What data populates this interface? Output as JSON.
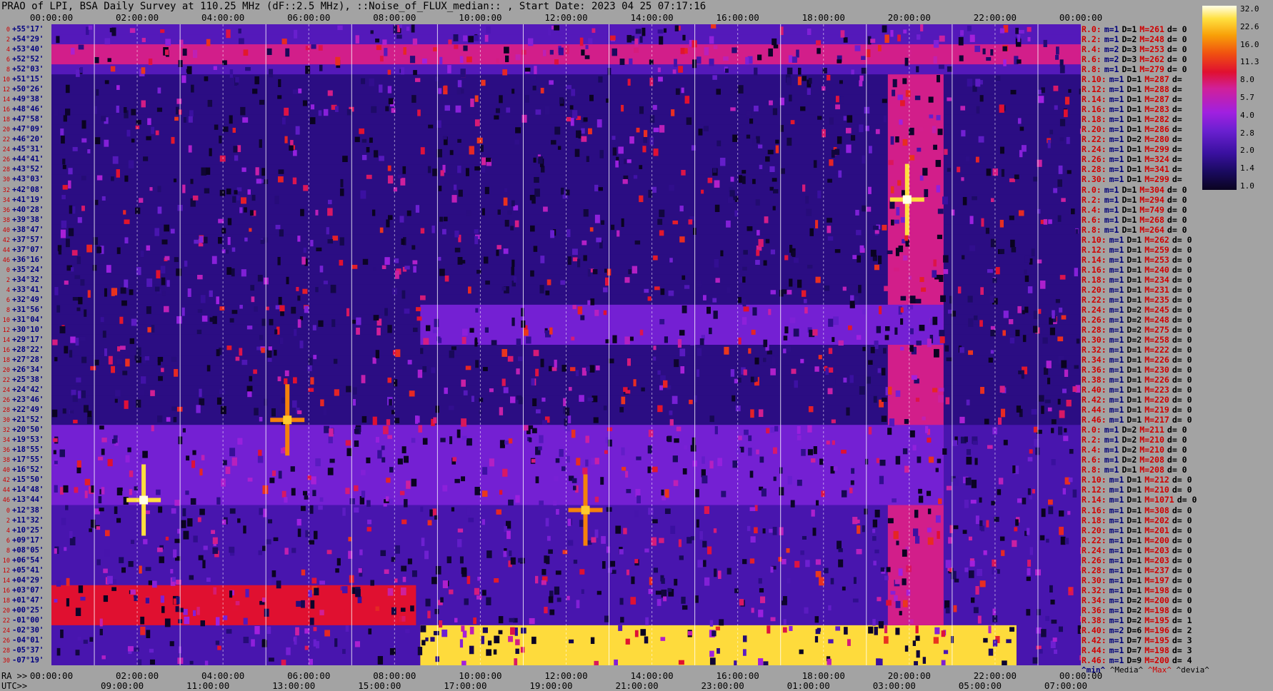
{
  "title": "PRAO of LPI, BSA Daily Survey at 110.25 MHz (dF::2.5 MHz), ::Noise_of_FLUX_median:: , Start Date: 2023 04 25 07:17:16",
  "top_axis_ticks": [
    "00:00:00",
    "02:00:00",
    "04:00:00",
    "06:00:00",
    "08:00:00",
    "10:00:00",
    "12:00:00",
    "14:00:00",
    "16:00:00",
    "18:00:00",
    "20:00:00",
    "22:00:00",
    "00:00:00"
  ],
  "ra_axis": {
    "caption": "RA >>",
    "ticks": [
      "00:00:00",
      "02:00:00",
      "04:00:00",
      "06:00:00",
      "08:00:00",
      "10:00:00",
      "12:00:00",
      "14:00:00",
      "16:00:00",
      "18:00:00",
      "20:00:00",
      "22:00:00",
      "00:00:00"
    ]
  },
  "utc_axis": {
    "caption": "UTC>>",
    "ticks": [
      "09:00:00",
      "11:00:00",
      "13:00:00",
      "15:00:00",
      "17:00:00",
      "19:00:00",
      "21:00:00",
      "23:00:00",
      "01:00:00",
      "03:00:00",
      "05:00:00",
      "07:00:00"
    ]
  },
  "colorbar": {
    "ticks": [
      "32.0",
      "22.6",
      "16.0",
      "11.3",
      "8.0",
      "5.7",
      "4.0",
      "2.8",
      "2.0",
      "1.4",
      "1.0"
    ]
  },
  "legend": {
    "min": "^min^",
    "media": "^Media^",
    "max": "^Max^",
    "devia": "^devia^"
  },
  "chart_data": {
    "type": "heatmap",
    "title": "PRAO of LPI, BSA Daily Survey at 110.25 MHz (dF::2.5 MHz), ::Noise_of_FLUX_median:: , Start Date: 2023 04 25 07:17:16",
    "xlabel": "RA / UTC",
    "ylabel": "",
    "x_range_hours": [
      0,
      24
    ],
    "colorbar_range": [
      1.0,
      32.0
    ],
    "colorbar_scale": "log",
    "colors": {
      "low": "#0a0320",
      "mid": "#a020e0",
      "high": "#ffffe8"
    },
    "declinations": [
      "+55°17'",
      "+54°29'",
      "+53°40'",
      "+52°52'",
      "+52°03'",
      "+51°15'",
      "+50°26'",
      "+49°38'",
      "+48°46'",
      "+47°58'",
      "+47°09'",
      "+46°20'",
      "+45°31'",
      "+44°41'",
      "+43°52'",
      "+43°03'",
      "+42°08'",
      "+41°19'",
      "+40°28'",
      "+39°38'",
      "+38°47'",
      "+37°57'",
      "+37°07'",
      "+36°16'",
      "+35°24'",
      "+34°32'",
      "+33°41'",
      "+32°49'",
      "+31°56'",
      "+31°04'",
      "+30°10'",
      "+29°17'",
      "+28°22'",
      "+27°28'",
      "+26°34'",
      "+25°38'",
      "+24°42'",
      "+23°46'",
      "+22°49'",
      "+21°52'",
      "+20°50'",
      "+19°53'",
      "+18°55'",
      "+17°55'",
      "+16°52'",
      "+15°50'",
      "+14°48'",
      "+13°44'",
      "+12°38'",
      "+11°32'",
      "+10°25'",
      "+09°17'",
      "+08°05'",
      "+06°54'",
      "+05°41'",
      "+04°29'",
      "+03°07'",
      "+01°47'",
      "+00°25'",
      "-01°00'",
      "-02°30'",
      "-04°01'",
      "-05°37'",
      "-07°19'"
    ],
    "row_indices": [
      0,
      2,
      4,
      6,
      8,
      10,
      12,
      14,
      16,
      18,
      20,
      22,
      24,
      26,
      28,
      30,
      32,
      34,
      36,
      38,
      40,
      42,
      44,
      46,
      0,
      2,
      4,
      6,
      8,
      10,
      12,
      14,
      16,
      18,
      20,
      22,
      24,
      26,
      28,
      30,
      32,
      34,
      36,
      38,
      40,
      42,
      44,
      46,
      0,
      2,
      4,
      6,
      8,
      10,
      12,
      14,
      16,
      18,
      20,
      22,
      24,
      26,
      28,
      30,
      32,
      34,
      36,
      38,
      40,
      42,
      44,
      46
    ],
    "beam_stats": [
      {
        "r": "R.0:",
        "m": "m=1",
        "D": "D=1",
        "M": "M=261",
        "d": "d= 0"
      },
      {
        "r": "R.2:",
        "m": "m=1",
        "D": "D=2",
        "M": "M=248",
        "d": "d= 0"
      },
      {
        "r": "R.4:",
        "m": "m=2",
        "D": "D=3",
        "M": "M=253",
        "d": "d= 0"
      },
      {
        "r": "R.6:",
        "m": "m=2",
        "D": "D=3",
        "M": "M=262",
        "d": "d= 0"
      },
      {
        "r": "R.8:",
        "m": "m=1",
        "D": "D=1",
        "M": "M=279",
        "d": "d= 0"
      },
      {
        "r": "R.10:",
        "m": "m=1",
        "D": "D=1",
        "M": "M=287",
        "d": "d="
      },
      {
        "r": "R.12:",
        "m": "m=1",
        "D": "D=1",
        "M": "M=288",
        "d": "d="
      },
      {
        "r": "R.14:",
        "m": "m=1",
        "D": "D=1",
        "M": "M=287",
        "d": "d="
      },
      {
        "r": "R.16:",
        "m": "m=1",
        "D": "D=1",
        "M": "M=283",
        "d": "d="
      },
      {
        "r": "R.18:",
        "m": "m=1",
        "D": "D=1",
        "M": "M=282",
        "d": "d="
      },
      {
        "r": "R.20:",
        "m": "m=1",
        "D": "D=1",
        "M": "M=286",
        "d": "d="
      },
      {
        "r": "R.22:",
        "m": "m=1",
        "D": "D=2",
        "M": "M=280",
        "d": "d="
      },
      {
        "r": "R.24:",
        "m": "m=1",
        "D": "D=1",
        "M": "M=299",
        "d": "d="
      },
      {
        "r": "R.26:",
        "m": "m=1",
        "D": "D=1",
        "M": "M=324",
        "d": "d="
      },
      {
        "r": "R.28:",
        "m": "m=1",
        "D": "D=1",
        "M": "M=341",
        "d": "d="
      },
      {
        "r": "R.30:",
        "m": "m=1",
        "D": "D=1",
        "M": "M=299",
        "d": "d="
      },
      {
        "r": "R.0:",
        "m": "m=1",
        "D": "D=1",
        "M": "M=304",
        "d": "d= 0"
      },
      {
        "r": "R.2:",
        "m": "m=1",
        "D": "D=1",
        "M": "M=294",
        "d": "d= 0"
      },
      {
        "r": "R.4:",
        "m": "m=1",
        "D": "D=1",
        "M": "M=749",
        "d": "d= 0"
      },
      {
        "r": "R.6:",
        "m": "m=1",
        "D": "D=1",
        "M": "M=268",
        "d": "d= 0"
      },
      {
        "r": "R.8:",
        "m": "m=1",
        "D": "D=1",
        "M": "M=264",
        "d": "d= 0"
      },
      {
        "r": "R.10:",
        "m": "m=1",
        "D": "D=1",
        "M": "M=262",
        "d": "d= 0"
      },
      {
        "r": "R.12:",
        "m": "m=1",
        "D": "D=1",
        "M": "M=259",
        "d": "d= 0"
      },
      {
        "r": "R.14:",
        "m": "m=1",
        "D": "D=1",
        "M": "M=253",
        "d": "d= 0"
      },
      {
        "r": "R.16:",
        "m": "m=1",
        "D": "D=1",
        "M": "M=240",
        "d": "d= 0"
      },
      {
        "r": "R.18:",
        "m": "m=1",
        "D": "D=1",
        "M": "M=234",
        "d": "d= 0"
      },
      {
        "r": "R.20:",
        "m": "m=1",
        "D": "D=1",
        "M": "M=231",
        "d": "d= 0"
      },
      {
        "r": "R.22:",
        "m": "m=1",
        "D": "D=1",
        "M": "M=235",
        "d": "d= 0"
      },
      {
        "r": "R.24:",
        "m": "m=1",
        "D": "D=2",
        "M": "M=245",
        "d": "d= 0"
      },
      {
        "r": "R.26:",
        "m": "m=1",
        "D": "D=2",
        "M": "M=248",
        "d": "d= 0"
      },
      {
        "r": "R.28:",
        "m": "m=1",
        "D": "D=2",
        "M": "M=275",
        "d": "d= 0"
      },
      {
        "r": "R.30:",
        "m": "m=1",
        "D": "D=2",
        "M": "M=258",
        "d": "d= 0"
      },
      {
        "r": "R.32:",
        "m": "m=1",
        "D": "D=1",
        "M": "M=222",
        "d": "d= 0"
      },
      {
        "r": "R.34:",
        "m": "m=1",
        "D": "D=1",
        "M": "M=226",
        "d": "d= 0"
      },
      {
        "r": "R.36:",
        "m": "m=1",
        "D": "D=1",
        "M": "M=230",
        "d": "d= 0"
      },
      {
        "r": "R.38:",
        "m": "m=1",
        "D": "D=1",
        "M": "M=226",
        "d": "d= 0"
      },
      {
        "r": "R.40:",
        "m": "m=1",
        "D": "D=1",
        "M": "M=223",
        "d": "d= 0"
      },
      {
        "r": "R.42:",
        "m": "m=1",
        "D": "D=1",
        "M": "M=220",
        "d": "d= 0"
      },
      {
        "r": "R.44:",
        "m": "m=1",
        "D": "D=1",
        "M": "M=219",
        "d": "d= 0"
      },
      {
        "r": "R.46:",
        "m": "m=1",
        "D": "D=1",
        "M": "M=217",
        "d": "d= 0"
      },
      {
        "r": "R.0:",
        "m": "m=1",
        "D": "D=2",
        "M": "M=211",
        "d": "d= 0"
      },
      {
        "r": "R.2:",
        "m": "m=1",
        "D": "D=2",
        "M": "M=210",
        "d": "d= 0"
      },
      {
        "r": "R.4:",
        "m": "m=1",
        "D": "D=2",
        "M": "M=210",
        "d": "d= 0"
      },
      {
        "r": "R.6:",
        "m": "m=1",
        "D": "D=2",
        "M": "M=208",
        "d": "d= 0"
      },
      {
        "r": "R.8:",
        "m": "m=1",
        "D": "D=1",
        "M": "M=208",
        "d": "d= 0"
      },
      {
        "r": "R.10:",
        "m": "m=1",
        "D": "D=1",
        "M": "M=212",
        "d": "d= 0"
      },
      {
        "r": "R.12:",
        "m": "m=1",
        "D": "D=1",
        "M": "M=210",
        "d": "d= 0"
      },
      {
        "r": "R.14:",
        "m": "m=1",
        "D": "D=1",
        "M": "M=1071",
        "d": "d= 0"
      },
      {
        "r": "R.16:",
        "m": "m=1",
        "D": "D=1",
        "M": "M=308",
        "d": "d= 0"
      },
      {
        "r": "R.18:",
        "m": "m=1",
        "D": "D=1",
        "M": "M=202",
        "d": "d= 0"
      },
      {
        "r": "R.20:",
        "m": "m=1",
        "D": "D=1",
        "M": "M=201",
        "d": "d= 0"
      },
      {
        "r": "R.22:",
        "m": "m=1",
        "D": "D=1",
        "M": "M=200",
        "d": "d= 0"
      },
      {
        "r": "R.24:",
        "m": "m=1",
        "D": "D=1",
        "M": "M=203",
        "d": "d= 0"
      },
      {
        "r": "R.26:",
        "m": "m=1",
        "D": "D=1",
        "M": "M=203",
        "d": "d= 0"
      },
      {
        "r": "R.28:",
        "m": "m=1",
        "D": "D=1",
        "M": "M=237",
        "d": "d= 0"
      },
      {
        "r": "R.30:",
        "m": "m=1",
        "D": "D=1",
        "M": "M=197",
        "d": "d= 0"
      },
      {
        "r": "R.32:",
        "m": "m=1",
        "D": "D=1",
        "M": "M=198",
        "d": "d= 0"
      },
      {
        "r": "R.34:",
        "m": "m=1",
        "D": "D=2",
        "M": "M=200",
        "d": "d= 0"
      },
      {
        "r": "R.36:",
        "m": "m=1",
        "D": "D=2",
        "M": "M=198",
        "d": "d= 0"
      },
      {
        "r": "R.38:",
        "m": "m=1",
        "D": "D=2",
        "M": "M=195",
        "d": "d= 1"
      },
      {
        "r": "R.40:",
        "m": "m=2",
        "D": "D=6",
        "M": "M=196",
        "d": "d= 2"
      },
      {
        "r": "R.42:",
        "m": "m=1",
        "D": "D=7",
        "M": "M=195",
        "d": "d= 3"
      },
      {
        "r": "R.44:",
        "m": "m=1",
        "D": "D=7",
        "M": "M=198",
        "d": "d= 3"
      },
      {
        "r": "R.46:",
        "m": "m=1",
        "D": "D=9",
        "M": "M=200",
        "d": "d= 4"
      }
    ],
    "features": [
      {
        "name": "bright band",
        "dec_rows": [
          2,
          3
        ],
        "ra_hours": [
          0,
          24
        ],
        "level": 6
      },
      {
        "name": "strong low-dec emission",
        "dec_rows": [
          60,
          63
        ],
        "ra_hours": [
          8.6,
          22.5
        ],
        "level": 22
      },
      {
        "name": "low-dec emission",
        "dec_rows": [
          56,
          59
        ],
        "ra_hours": [
          0,
          8.5
        ],
        "level": 8
      },
      {
        "name": "galactic plane arc",
        "dec_rows": [
          5,
          59
        ],
        "ra_hours": [
          19.5,
          20.8
        ],
        "level": 6
      },
      {
        "name": "enhanced band",
        "dec_rows": [
          28,
          31
        ],
        "ra_hours": [
          8.6,
          20.8
        ],
        "level": 3
      },
      {
        "name": "enhanced band",
        "dec_rows": [
          40,
          47
        ],
        "ra_hours": [
          0,
          20.8
        ],
        "level": 3
      },
      {
        "name": "point source",
        "dec_row": 17,
        "ra_hour": 19.95,
        "level": 32
      },
      {
        "name": "point source",
        "dec_row": 47,
        "ra_hour": 2.15,
        "level": 32
      },
      {
        "name": "point source",
        "dec_row": 48,
        "ra_hour": 12.45,
        "level": 20
      },
      {
        "name": "point source",
        "dec_row": 39,
        "ra_hour": 5.5,
        "level": 20
      }
    ]
  }
}
